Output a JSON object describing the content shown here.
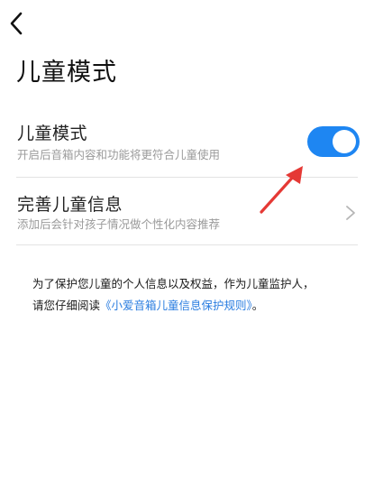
{
  "header": {
    "back_icon": "chevron-left-icon",
    "title": "儿童模式"
  },
  "settings": {
    "kids_mode": {
      "title": "儿童模式",
      "subtitle": "开启后音箱内容和功能将更符合儿童使用",
      "enabled": true,
      "toggle_color": "#1E86F2"
    },
    "child_info": {
      "title": "完善儿童信息",
      "subtitle": "添加后会针对孩子情况做个性化内容推荐",
      "icon": "chevron-right-icon"
    }
  },
  "notice": {
    "line1": "为了保护您儿童的个人信息以及权益，作为儿童监护人，",
    "line2_prefix": "请您仔细阅读",
    "link": "《小爱音箱儿童信息保护规则》",
    "line2_suffix": "。",
    "link_color": "#2A7DE0"
  },
  "annotation": {
    "arrow_color": "#E53935"
  }
}
